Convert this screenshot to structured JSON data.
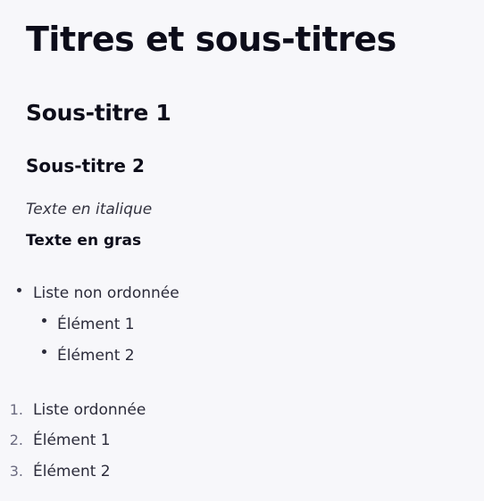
{
  "document": {
    "title": "Titres et sous-titres",
    "subtitle1": "Sous-titre 1",
    "subtitle2": "Sous-titre 2",
    "italic_text": "Texte en italique",
    "bold_text": "Texte en gras",
    "unordered_list": {
      "item": "Liste non ordonnée",
      "children": [
        "Élément 1",
        "Élément 2"
      ]
    },
    "ordered_list": {
      "numbers": [
        "1.",
        "2.",
        "3."
      ],
      "items": [
        "Liste ordonnée",
        "Élément 1",
        "Élément 2"
      ]
    }
  }
}
